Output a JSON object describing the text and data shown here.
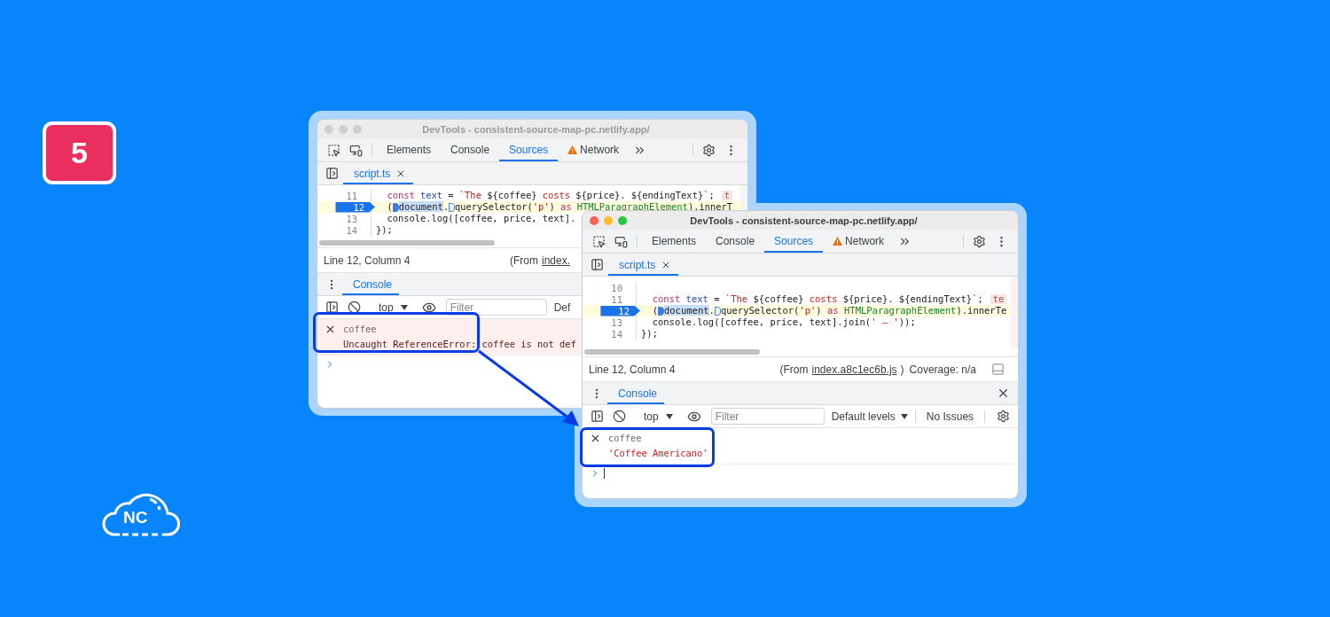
{
  "step_badge": {
    "label": "5"
  },
  "logo": {
    "label": "NC"
  },
  "windows": [
    {
      "title": "DevTools - consistent-source-map-pc.netlify.app/",
      "focused": false,
      "tabs": [
        {
          "label": "Elements",
          "selected": false,
          "warning": false
        },
        {
          "label": "Console",
          "selected": false,
          "warning": false
        },
        {
          "label": "Sources",
          "selected": true,
          "warning": false
        },
        {
          "label": "Network",
          "selected": false,
          "warning": true
        }
      ],
      "file_tab": {
        "label": "script.ts"
      },
      "code_lines": [
        {
          "number": "11",
          "current": false,
          "hint": "t",
          "tokens": [
            {
              "kind": "keyword",
              "text": "  const"
            },
            {
              "kind": "name",
              "text": " text"
            },
            {
              "kind": "plain",
              "text": " = "
            },
            {
              "kind": "string",
              "text": "`The "
            },
            {
              "kind": "plain",
              "text": "${coffee}"
            },
            {
              "kind": "string",
              "text": " costs "
            },
            {
              "kind": "plain",
              "text": "${price}"
            },
            {
              "kind": "string",
              "text": ". "
            },
            {
              "kind": "plain",
              "text": "${endingText}"
            },
            {
              "kind": "string",
              "text": "`"
            },
            {
              "kind": "plain",
              "text": ";"
            }
          ]
        },
        {
          "number": "12",
          "current": true,
          "tokens": [
            {
              "kind": "plain",
              "text": "  ("
            },
            {
              "kind": "marker"
            },
            {
              "kind": "selection",
              "text": "document"
            },
            {
              "kind": "plain",
              "text": "."
            },
            {
              "kind": "marker-outline"
            },
            {
              "kind": "plain",
              "text": "querySelector("
            },
            {
              "kind": "string",
              "text": "'p'"
            },
            {
              "kind": "plain",
              "text": ") "
            },
            {
              "kind": "keyword",
              "text": "as "
            },
            {
              "kind": "type",
              "text": "HTMLParagraphElement"
            },
            {
              "kind": "plain",
              "text": ").innerT"
            }
          ]
        },
        {
          "number": "13",
          "current": false,
          "tokens": [
            {
              "kind": "plain",
              "text": "  console.log([coffee, price, text]."
            }
          ]
        },
        {
          "number": "14",
          "current": false,
          "tokens": [
            {
              "kind": "plain",
              "text": "});"
            }
          ]
        }
      ],
      "status": {
        "position": "Line 12, Column 4",
        "from_label": "(From",
        "source_link": "index."
      },
      "drawer": {
        "tab": "Console"
      },
      "console_toolbar": {
        "context": "top",
        "filter_placeholder": "Filter",
        "levels": "Def"
      },
      "messages": [
        {
          "expression": "coffee",
          "result": "Uncaught ReferenceError: coffee is not def",
          "kind": "error",
          "highlighted": true
        }
      ]
    },
    {
      "title": "DevTools - consistent-source-map-pc.netlify.app/",
      "focused": true,
      "tabs": [
        {
          "label": "Elements",
          "selected": false,
          "warning": false
        },
        {
          "label": "Console",
          "selected": false,
          "warning": false
        },
        {
          "label": "Sources",
          "selected": true,
          "warning": false
        },
        {
          "label": "Network",
          "selected": false,
          "warning": true
        }
      ],
      "file_tab": {
        "label": "script.ts"
      },
      "code_lines": [
        {
          "number": "10",
          "current": false
        },
        {
          "number": "11",
          "current": false,
          "hint": "te",
          "tokens": [
            {
              "kind": "keyword",
              "text": "  const"
            },
            {
              "kind": "name",
              "text": " text"
            },
            {
              "kind": "plain",
              "text": " = "
            },
            {
              "kind": "string",
              "text": "`The "
            },
            {
              "kind": "plain",
              "text": "${coffee}"
            },
            {
              "kind": "string",
              "text": " costs "
            },
            {
              "kind": "plain",
              "text": "${price}"
            },
            {
              "kind": "string",
              "text": ". "
            },
            {
              "kind": "plain",
              "text": "${endingText}"
            },
            {
              "kind": "string",
              "text": "`"
            },
            {
              "kind": "plain",
              "text": ";"
            }
          ]
        },
        {
          "number": "12",
          "current": true,
          "tokens": [
            {
              "kind": "plain",
              "text": "  ("
            },
            {
              "kind": "marker"
            },
            {
              "kind": "selection",
              "text": "document"
            },
            {
              "kind": "plain",
              "text": "."
            },
            {
              "kind": "marker-outline"
            },
            {
              "kind": "plain",
              "text": "querySelector("
            },
            {
              "kind": "string",
              "text": "'p'"
            },
            {
              "kind": "plain",
              "text": ") "
            },
            {
              "kind": "keyword",
              "text": "as "
            },
            {
              "kind": "type",
              "text": "HTMLParagraphElement"
            },
            {
              "kind": "plain",
              "text": ").innerTe"
            }
          ]
        },
        {
          "number": "13",
          "current": false,
          "tokens": [
            {
              "kind": "plain",
              "text": "  console.log([coffee, price, text].join("
            },
            {
              "kind": "string",
              "text": "' – '"
            },
            {
              "kind": "plain",
              "text": "));"
            }
          ]
        },
        {
          "number": "14",
          "current": false,
          "tokens": [
            {
              "kind": "plain",
              "text": "});"
            }
          ]
        }
      ],
      "status": {
        "position": "Line 12, Column 4",
        "from_label": "(From",
        "source_link": "index.a8c1ec6b.js",
        "closing": ")",
        "coverage": "Coverage: n/a"
      },
      "drawer": {
        "tab": "Console",
        "closable": true
      },
      "console_toolbar": {
        "context": "top",
        "filter_placeholder": "Filter",
        "levels": "Default levels",
        "levels_caret": true,
        "issues": "No Issues",
        "settings": true
      },
      "messages": [
        {
          "expression": "coffee",
          "result": "'Coffee Americano'",
          "kind": "value",
          "highlighted": true
        }
      ],
      "prompt_cursor": true
    }
  ]
}
